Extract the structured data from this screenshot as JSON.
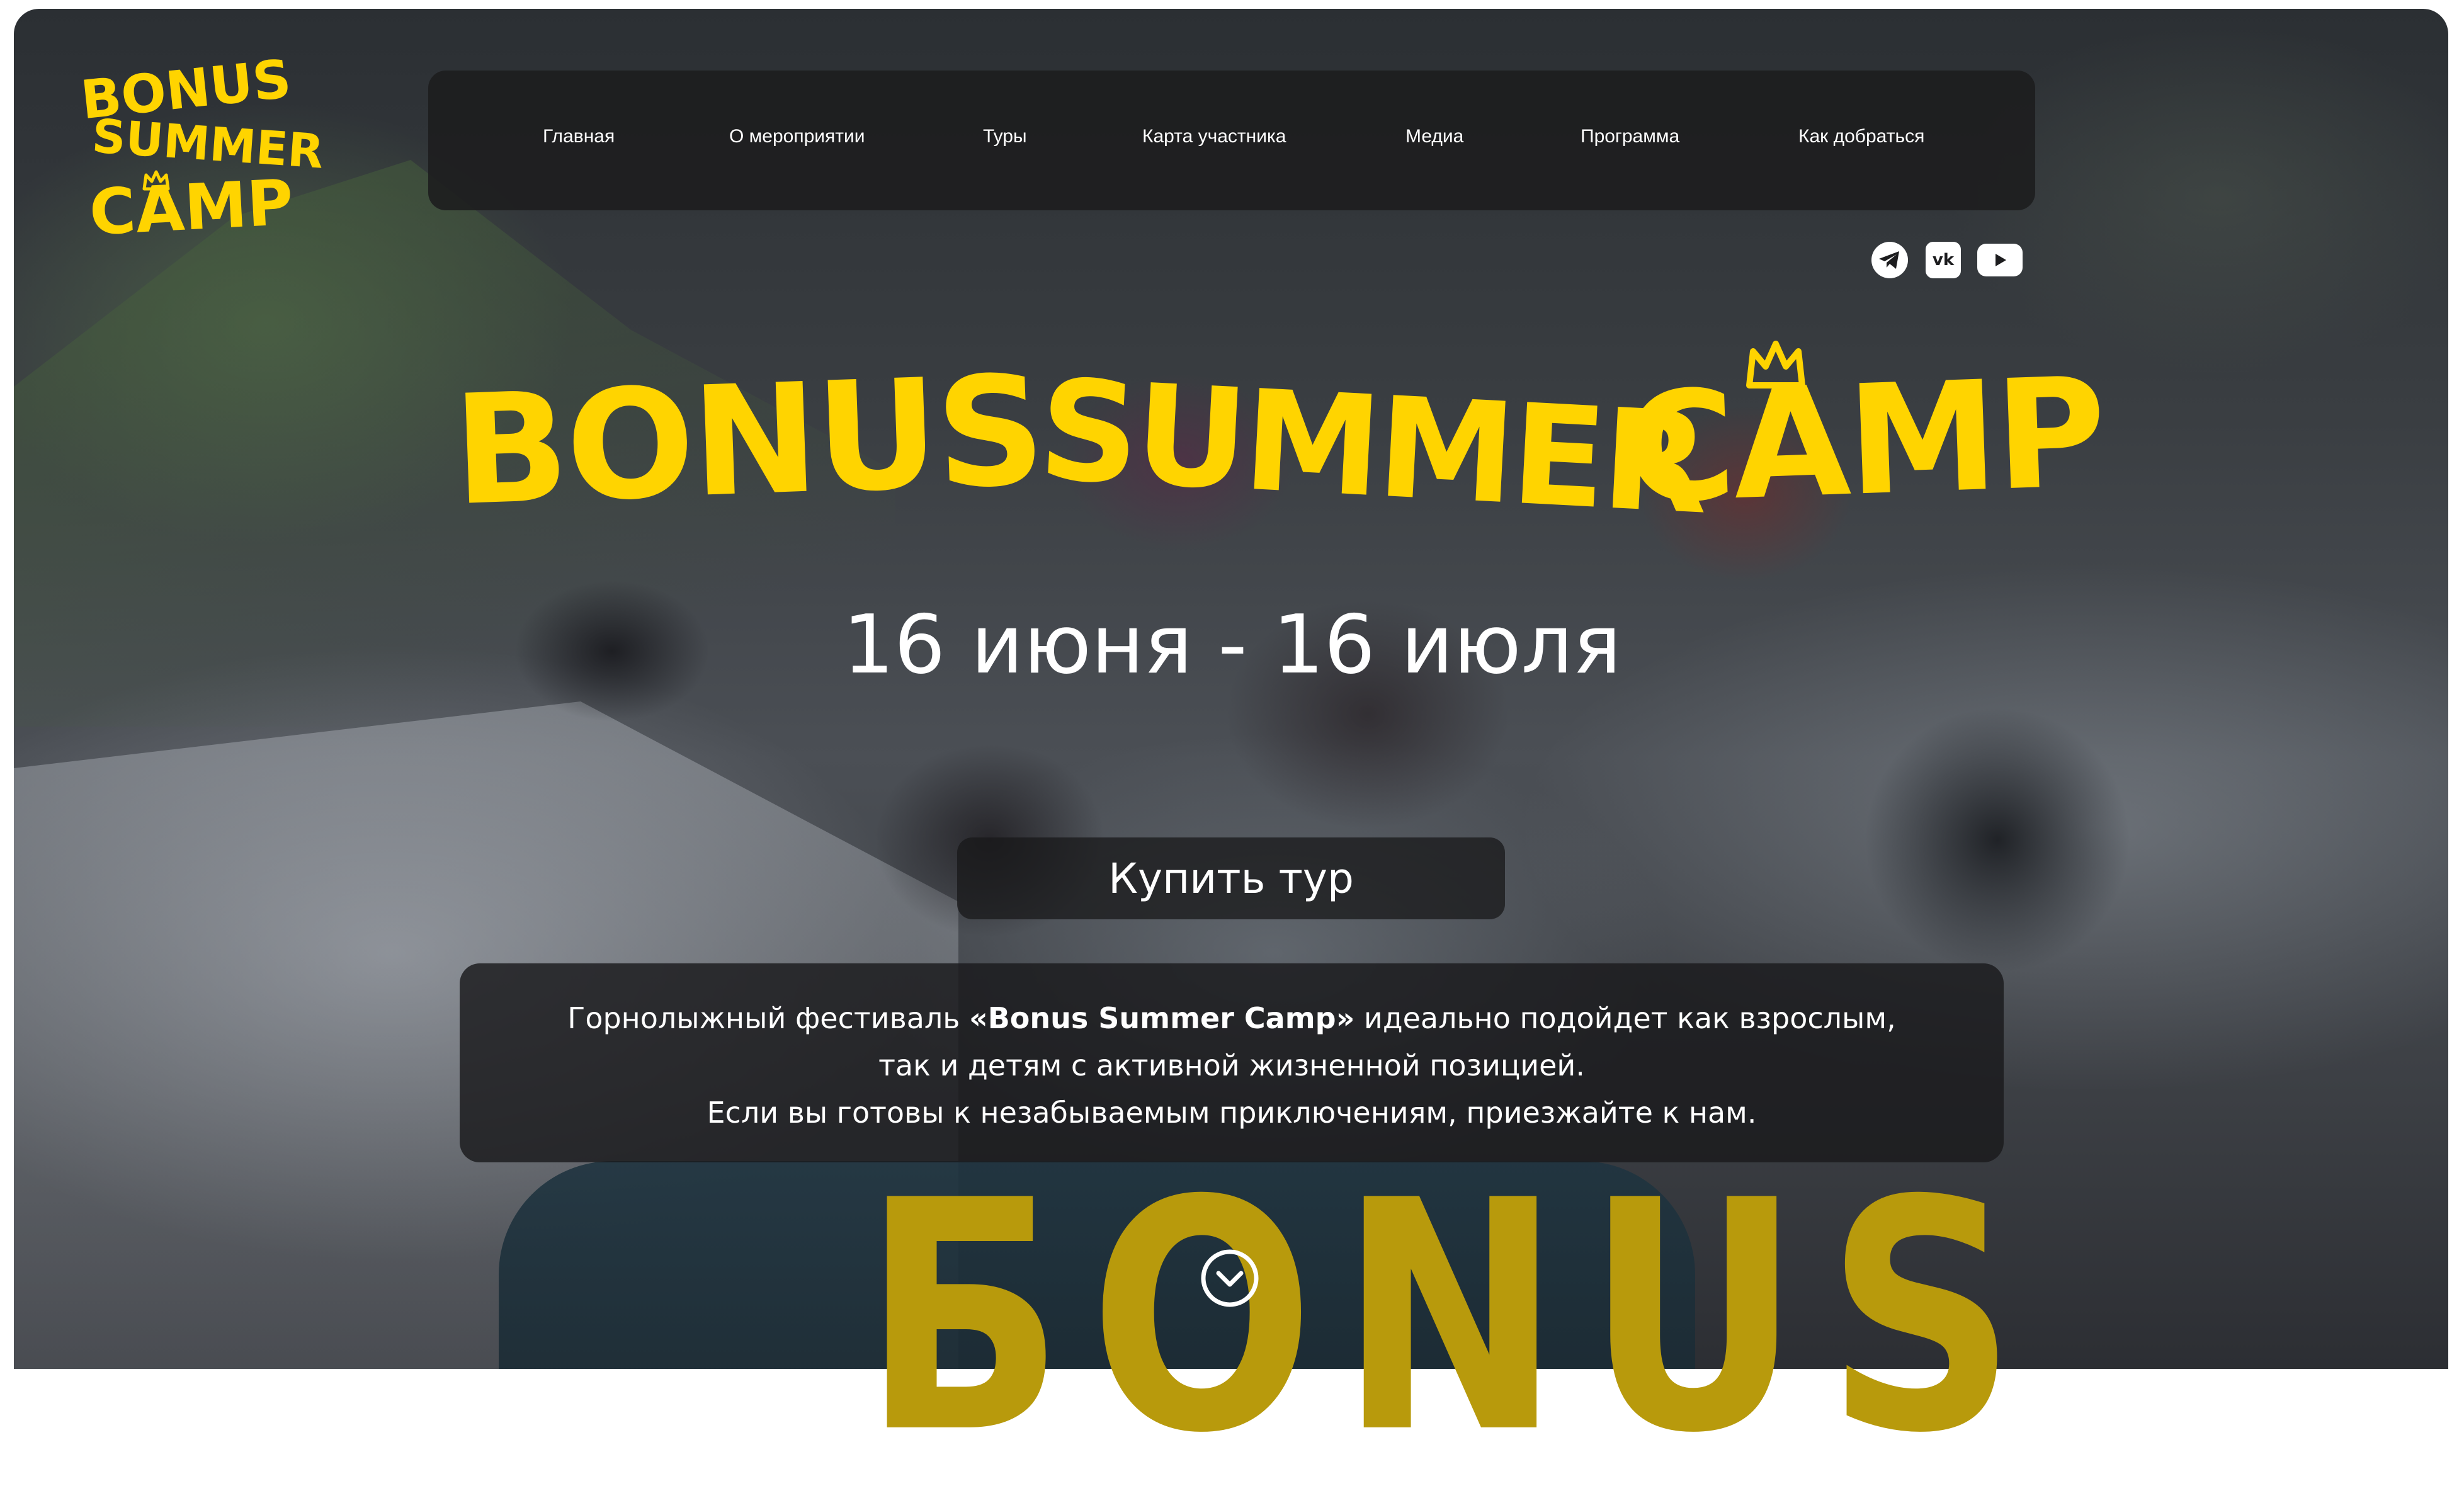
{
  "logo": {
    "line1": "BONUS",
    "line2": "SUMMER",
    "line3": "CAMP"
  },
  "nav": {
    "items": [
      {
        "label": "Главная"
      },
      {
        "label": "О мероприятии"
      },
      {
        "label": "Туры"
      },
      {
        "label": "Карта участника"
      },
      {
        "label": "Медиа"
      },
      {
        "label": "Программа"
      },
      {
        "label": "Как добраться"
      }
    ]
  },
  "social": {
    "icons": [
      "telegram-icon",
      "vk-icon",
      "youtube-icon"
    ],
    "vk_text": "vk"
  },
  "hero": {
    "title_word1": "BONUS",
    "title_word2": "SUMMER",
    "title_word3": "CAMP",
    "dates": "16 июня - 16 июля",
    "buy_label": "Купить тур"
  },
  "description": {
    "line1_before": "Горнолыжный фестиваль ",
    "line1_bold": "«Bonus Summer Camp»",
    "line1_after": " идеально подойдет как взрослым,",
    "line2": "так и детям с активной жизненной позицией.",
    "line3": "Если вы готовы к незабываемым приключениям, приезжайте к нам."
  },
  "background": {
    "board_text": "БONUS"
  },
  "colors": {
    "brand_yellow": "#ffd400",
    "panel_dark": "#1c1c1e",
    "text": "#ffffff"
  }
}
